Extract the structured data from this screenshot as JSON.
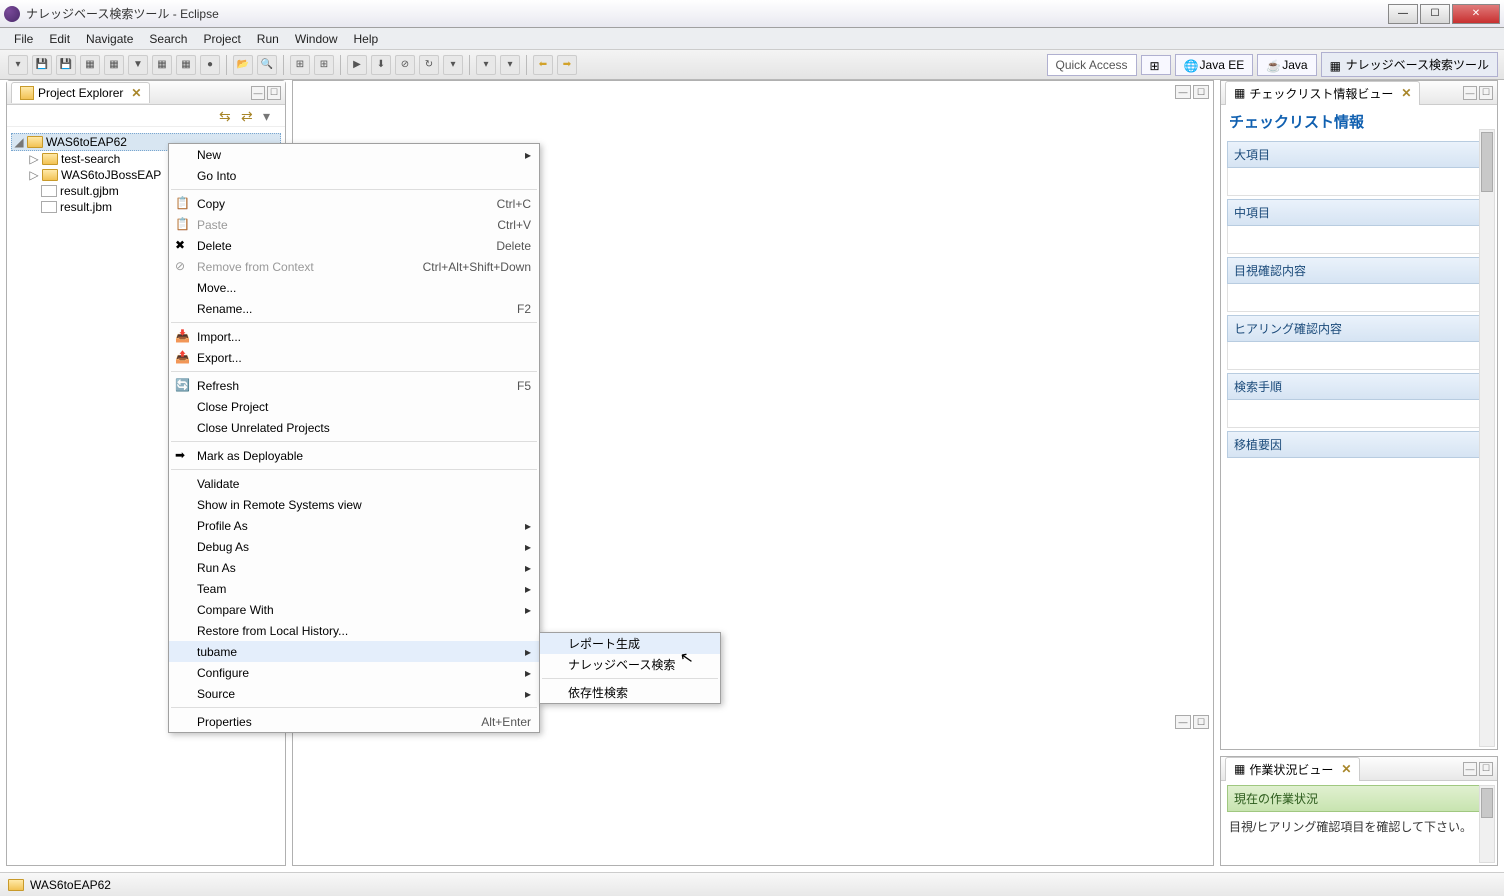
{
  "window": {
    "title": "ナレッジベース検索ツール - Eclipse"
  },
  "menus": {
    "file": "File",
    "edit": "Edit",
    "navigate": "Navigate",
    "search": "Search",
    "project": "Project",
    "run": "Run",
    "window": "Window",
    "help": "Help"
  },
  "quickaccess": "Quick Access",
  "perspectives": {
    "javaee": "Java EE",
    "java": "Java",
    "knowledge": "ナレッジベース検索ツール"
  },
  "views": {
    "project_explorer": {
      "title": "Project Explorer"
    },
    "checklist": {
      "title": "チェックリスト情報ビュー",
      "heading": "チェックリスト情報",
      "sections": [
        "大項目",
        "中項目",
        "目視確認内容",
        "ヒアリング確認内容",
        "検索手順",
        "移植要因"
      ]
    },
    "workstatus": {
      "title": "作業状況ビュー",
      "current_label": "現在の作業状況",
      "message": "目視/ヒアリング確認項目を確認して下さい。"
    }
  },
  "tree": {
    "root": "WAS6toEAP62",
    "children": [
      {
        "label": "test-search",
        "type": "folder"
      },
      {
        "label": "WAS6toJBossEAP",
        "type": "folder"
      },
      {
        "label": "result.gjbm",
        "type": "file"
      },
      {
        "label": "result.jbm",
        "type": "file"
      }
    ]
  },
  "context_menu": {
    "items": [
      {
        "label": "New",
        "submenu": true
      },
      {
        "label": "Go Into"
      },
      {
        "sep": true
      },
      {
        "label": "Copy",
        "shortcut": "Ctrl+C",
        "icon": "copy"
      },
      {
        "label": "Paste",
        "shortcut": "Ctrl+V",
        "icon": "paste",
        "disabled": true
      },
      {
        "label": "Delete",
        "shortcut": "Delete",
        "icon": "delete"
      },
      {
        "label": "Remove from Context",
        "shortcut": "Ctrl+Alt+Shift+Down",
        "icon": "remove",
        "disabled": true
      },
      {
        "label": "Move..."
      },
      {
        "label": "Rename...",
        "shortcut": "F2"
      },
      {
        "sep": true
      },
      {
        "label": "Import...",
        "icon": "import"
      },
      {
        "label": "Export...",
        "icon": "export"
      },
      {
        "sep": true
      },
      {
        "label": "Refresh",
        "shortcut": "F5",
        "icon": "refresh"
      },
      {
        "label": "Close Project"
      },
      {
        "label": "Close Unrelated Projects"
      },
      {
        "sep": true
      },
      {
        "label": "Mark as Deployable",
        "icon": "deploy"
      },
      {
        "sep": true
      },
      {
        "label": "Validate"
      },
      {
        "label": "Show in Remote Systems view"
      },
      {
        "label": "Profile As",
        "submenu": true
      },
      {
        "label": "Debug As",
        "submenu": true
      },
      {
        "label": "Run As",
        "submenu": true
      },
      {
        "label": "Team",
        "submenu": true
      },
      {
        "label": "Compare With",
        "submenu": true
      },
      {
        "label": "Restore from Local History..."
      },
      {
        "label": "tubame",
        "submenu": true,
        "hovered": true
      },
      {
        "label": "Configure",
        "submenu": true
      },
      {
        "label": "Source",
        "submenu": true
      },
      {
        "sep": true
      },
      {
        "label": "Properties",
        "shortcut": "Alt+Enter"
      }
    ],
    "submenu_tubame": [
      {
        "label": "レポート生成",
        "hovered": true
      },
      {
        "label": "ナレッジベース検索"
      },
      {
        "sep": true
      },
      {
        "label": "依存性検索"
      }
    ]
  },
  "statusbar": {
    "path": "WAS6toEAP62"
  }
}
